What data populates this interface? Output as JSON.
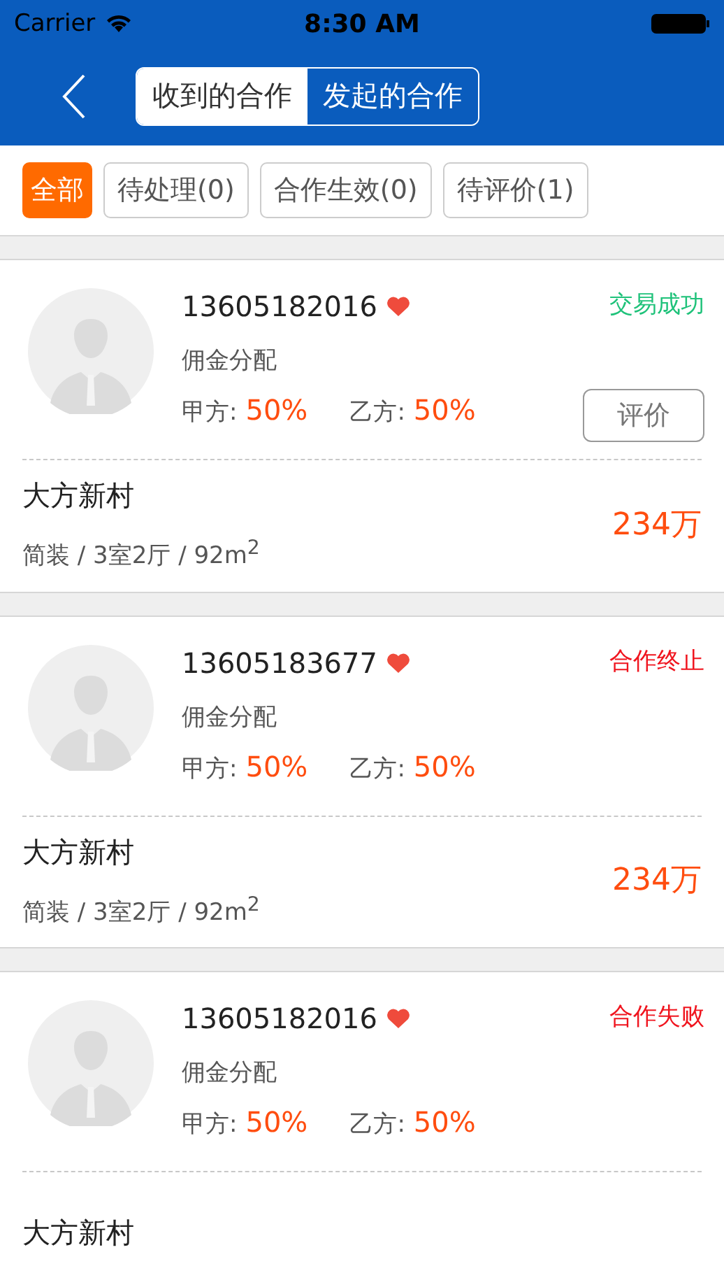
{
  "status_bar": {
    "carrier": "Carrier",
    "time": "8:30 AM"
  },
  "segments": [
    {
      "label": "收到的合作",
      "selected": false
    },
    {
      "label": "发起的合作",
      "selected": true
    }
  ],
  "filters": [
    {
      "label": "全部",
      "selected": true
    },
    {
      "label": "待处理(0)",
      "selected": false
    },
    {
      "label": "合作生效(0)",
      "selected": false
    },
    {
      "label": "待评价(1)",
      "selected": false
    }
  ],
  "cards": [
    {
      "phone": "13605182016",
      "status": "交易成功",
      "color": "#1fc27a",
      "subtitle": "佣金分配",
      "party_a_label": "甲方:",
      "party_a": "50%",
      "party_b_label": "乙方:",
      "party_b": "50%",
      "action": "评价",
      "estate": "大方新村",
      "details": "简装 / 3室2厅 / 92m$^{2}$",
      "price": "234万"
    },
    {
      "phone": "13605183677",
      "status": "合作终止",
      "color": "#f0141e",
      "subtitle": "佣金分配",
      "party_a_label": "甲方:",
      "party_a": "50%",
      "party_b_label": "乙方:",
      "party_b": "50%",
      "estate": "大方新村",
      "details": "简装 / 3室2厅 / 92m$^{2}$",
      "price": "234万"
    },
    {
      "phone": "13605182016",
      "status": "合作失败",
      "color": "#f0141e",
      "subtitle": "佣金分配",
      "party_a_label": "甲方:",
      "party_a": "50%",
      "party_b_label": "乙方:",
      "party_b": "50%",
      "estate": "大方新村"
    }
  ]
}
